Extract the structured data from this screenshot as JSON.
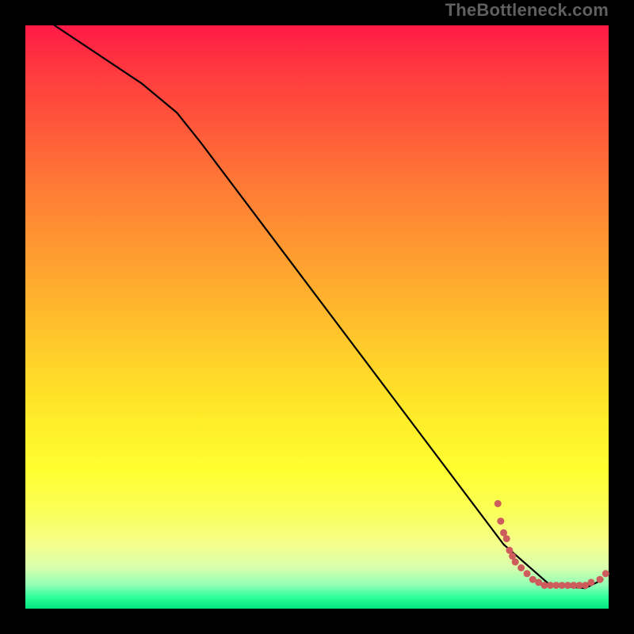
{
  "watermark": "TheBottleneck.com",
  "chart_data": {
    "type": "line",
    "title": "",
    "xlabel": "",
    "ylabel": "",
    "xlim": [
      0,
      100
    ],
    "ylim": [
      0,
      100
    ],
    "curve": [
      {
        "x": 5,
        "y": 100
      },
      {
        "x": 20,
        "y": 90
      },
      {
        "x": 26,
        "y": 85
      },
      {
        "x": 30,
        "y": 80
      },
      {
        "x": 82,
        "y": 11
      },
      {
        "x": 90,
        "y": 4
      },
      {
        "x": 96,
        "y": 3.5
      },
      {
        "x": 99,
        "y": 5
      }
    ],
    "scatter": [
      {
        "x": 81,
        "y": 18
      },
      {
        "x": 81.5,
        "y": 15
      },
      {
        "x": 82,
        "y": 13
      },
      {
        "x": 82.5,
        "y": 12
      },
      {
        "x": 83,
        "y": 10
      },
      {
        "x": 83.5,
        "y": 9
      },
      {
        "x": 84,
        "y": 8
      },
      {
        "x": 85,
        "y": 7
      },
      {
        "x": 86,
        "y": 6
      },
      {
        "x": 87,
        "y": 5
      },
      {
        "x": 88,
        "y": 4.5
      },
      {
        "x": 89,
        "y": 4
      },
      {
        "x": 90,
        "y": 4
      },
      {
        "x": 91,
        "y": 4
      },
      {
        "x": 92,
        "y": 4
      },
      {
        "x": 93,
        "y": 4
      },
      {
        "x": 94,
        "y": 4
      },
      {
        "x": 95,
        "y": 4
      },
      {
        "x": 96,
        "y": 4
      },
      {
        "x": 97,
        "y": 4.5
      },
      {
        "x": 98.5,
        "y": 5
      },
      {
        "x": 99.5,
        "y": 6
      }
    ]
  },
  "colors": {
    "curve": "#000000",
    "scatter": "#cd5c5c"
  }
}
